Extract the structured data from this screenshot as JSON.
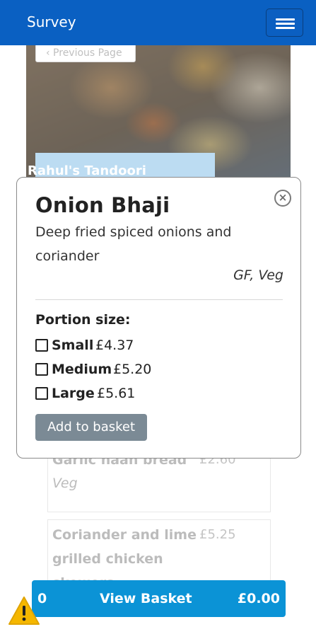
{
  "navbar": {
    "brand": "Survey",
    "menu_icon": "hamburger-icon"
  },
  "hero": {
    "previous_page": "‹ Previous Page",
    "restaurant_name": "Rahul's Tandoori"
  },
  "menu_cards": [
    {
      "name": "Garlic naan bread",
      "price": "£2.60",
      "tag": "Veg"
    },
    {
      "name_line1": "Coriander and lime",
      "name_line2": "grilled chicken",
      "name_line3": "skewers",
      "price": "£5.25"
    }
  ],
  "modal": {
    "title": "Onion Bhaji",
    "description": "Deep fried spiced onions and coriander",
    "tags": "GF, Veg",
    "portion_label": "Portion size:",
    "options": [
      {
        "name": "Small",
        "price": "£4.37",
        "checked": false
      },
      {
        "name": "Medium",
        "price": "£5.20",
        "checked": false
      },
      {
        "name": "Large",
        "price": "£5.61",
        "checked": false
      }
    ],
    "add_button": "Add to basket",
    "close_icon": "close-circle-icon"
  },
  "basket": {
    "count": "0",
    "label": "View Basket",
    "total": "£0.00"
  },
  "warning_icon": "warning-triangle-icon",
  "colors": {
    "navbar": "#0a60c2",
    "basket": "#0b93d6",
    "add_button": "#7b8a95",
    "warning": "#f5b700"
  }
}
